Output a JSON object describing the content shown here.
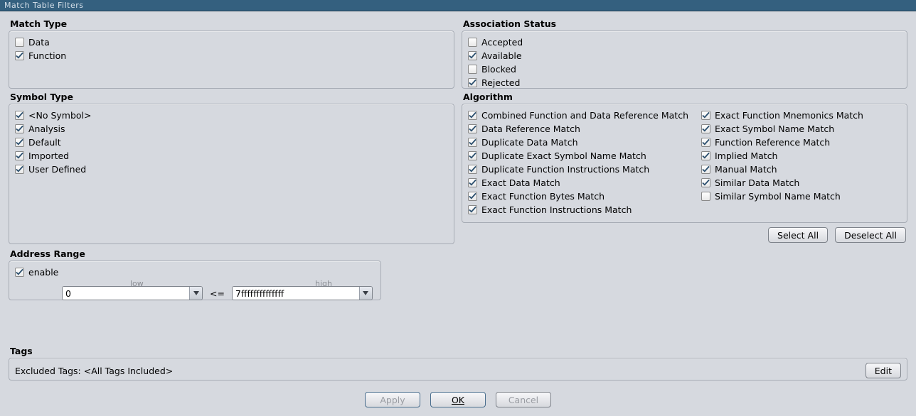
{
  "title": "Match Table Filters",
  "groups": {
    "matchType": {
      "title": "Match Type",
      "items": [
        {
          "label": "Data",
          "checked": false
        },
        {
          "label": "Function",
          "checked": true
        }
      ]
    },
    "symbolType": {
      "title": "Symbol Type",
      "items": [
        {
          "label": "<No Symbol>",
          "checked": true
        },
        {
          "label": "Analysis",
          "checked": true
        },
        {
          "label": "Default",
          "checked": true
        },
        {
          "label": "Imported",
          "checked": true
        },
        {
          "label": "User Defined",
          "checked": true
        }
      ]
    },
    "assocStatus": {
      "title": "Association Status",
      "items": [
        {
          "label": "Accepted",
          "checked": false
        },
        {
          "label": "Available",
          "checked": true
        },
        {
          "label": "Blocked",
          "checked": false
        },
        {
          "label": "Rejected",
          "checked": true
        }
      ]
    },
    "algorithm": {
      "title": "Algorithm",
      "col1": [
        {
          "label": "Combined Function and Data Reference Match",
          "checked": true
        },
        {
          "label": "Data Reference Match",
          "checked": true
        },
        {
          "label": "Duplicate Data Match",
          "checked": true
        },
        {
          "label": "Duplicate Exact Symbol Name Match",
          "checked": true
        },
        {
          "label": "Duplicate Function Instructions Match",
          "checked": true
        },
        {
          "label": "Exact Data Match",
          "checked": true
        },
        {
          "label": "Exact Function Bytes Match",
          "checked": true
        },
        {
          "label": "Exact Function Instructions Match",
          "checked": true
        }
      ],
      "col2": [
        {
          "label": "Exact Function Mnemonics Match",
          "checked": true
        },
        {
          "label": "Exact Symbol Name Match",
          "checked": true
        },
        {
          "label": "Function Reference Match",
          "checked": true
        },
        {
          "label": "Implied Match",
          "checked": true
        },
        {
          "label": "Manual Match",
          "checked": true
        },
        {
          "label": "Similar Data Match",
          "checked": true
        },
        {
          "label": "Similar Symbol Name Match",
          "checked": false
        }
      ]
    },
    "addressRange": {
      "title": "Address Range",
      "enableLabel": "enable",
      "enableChecked": true,
      "lowLabel": "low",
      "highLabel": "high",
      "lowValue": "0",
      "operator": "<=",
      "highValue": "7ffffffffffffff"
    },
    "tags": {
      "title": "Tags",
      "text": "Excluded Tags: <All Tags Included>",
      "editLabel": "Edit"
    }
  },
  "buttons": {
    "selectAll": "Select All",
    "deselectAll": "Deselect All",
    "apply": "Apply",
    "ok": "OK",
    "cancel": "Cancel"
  }
}
